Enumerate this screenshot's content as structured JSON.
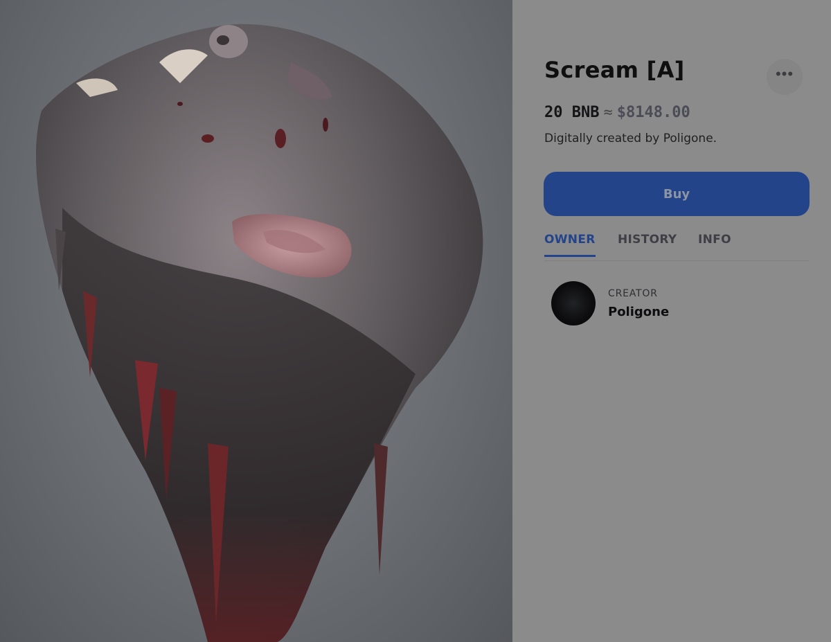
{
  "artwork": {
    "alt": "Scream [A]"
  },
  "item": {
    "title": "Scream [A]",
    "price_crypto": "20 BNB",
    "approx_symbol": "≈",
    "price_fiat": "$8148.00",
    "description": "Digitally created by Poligone."
  },
  "actions": {
    "more_icon": "more-horizontal-icon",
    "more_glyph": "•••",
    "buy_label": "Buy"
  },
  "tabs": [
    {
      "label": "OWNER",
      "active": true
    },
    {
      "label": "HISTORY",
      "active": false
    },
    {
      "label": "INFO",
      "active": false
    }
  ],
  "creator": {
    "caption": "CREATOR",
    "name": "Poligone"
  },
  "colors": {
    "accent": "#234489",
    "panel_bg": "#8b8b8b",
    "text_primary": "#0f0f10"
  }
}
